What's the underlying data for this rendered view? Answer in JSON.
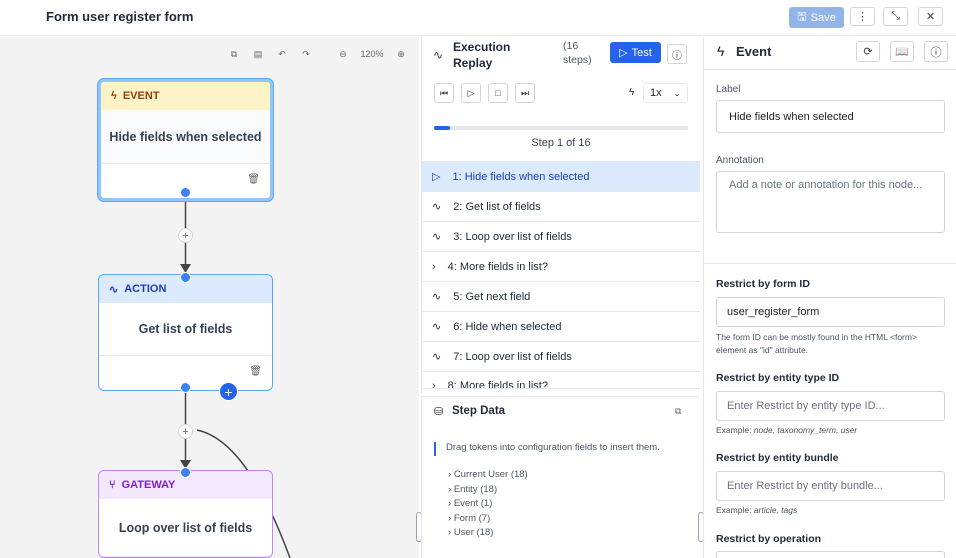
{
  "header": {
    "title": "Form user register form",
    "save_label": "Save"
  },
  "canvas": {
    "zoom": "120%"
  },
  "nodes": [
    {
      "type": "EVENT",
      "label": "Hide fields when selected",
      "color": "#fef3c7"
    },
    {
      "type": "ACTION",
      "label": "Get list of fields",
      "color": "#dbeafe"
    },
    {
      "type": "GATEWAY",
      "label": "Loop over list of fields",
      "color": "#f3e8ff"
    }
  ],
  "replay": {
    "title_line1": "Execution",
    "title_line2": "Replay",
    "steps_count": "(16 steps)",
    "test_label": "Test",
    "speed": "1x",
    "progress": 0.0625,
    "step_text": "Step 1 of 16",
    "steps": [
      "1: Hide fields when selected",
      "2: Get list of fields",
      "3: Loop over list of fields",
      "4: More fields in list?",
      "5: Get next field",
      "6: Hide when selected",
      "7: Loop over list of fields",
      "8: More fields in list?"
    ]
  },
  "step_data": {
    "title": "Step Data",
    "hint": "Drag tokens into configuration fields to insert them.",
    "tokens": [
      "Current User (18)",
      "Entity (18)",
      "Event (1)",
      "Form (7)",
      "User (18)"
    ]
  },
  "panel": {
    "title": "Event",
    "label_caption": "Label",
    "label_value": "Hide fields when selected",
    "annotation_caption": "Annotation",
    "annotation_placeholder": "Add a note or annotation for this node...",
    "form_id_caption": "Restrict by form ID",
    "form_id_value": "user_register_form",
    "form_id_help": "The form ID can be mostly found in the HTML <form> element as \"id\" attribute.",
    "entity_type_caption": "Restrict by entity type ID",
    "entity_type_placeholder": "Enter Restrict by entity type ID...",
    "entity_type_example_prefix": "Example: ",
    "entity_type_example": "node, taxonomy_term, user",
    "bundle_caption": "Restrict by entity bundle",
    "bundle_placeholder": "Enter Restrict by entity bundle...",
    "bundle_example_prefix": "Example: ",
    "bundle_example": "article, tags",
    "operation_caption": "Restrict by operation"
  }
}
